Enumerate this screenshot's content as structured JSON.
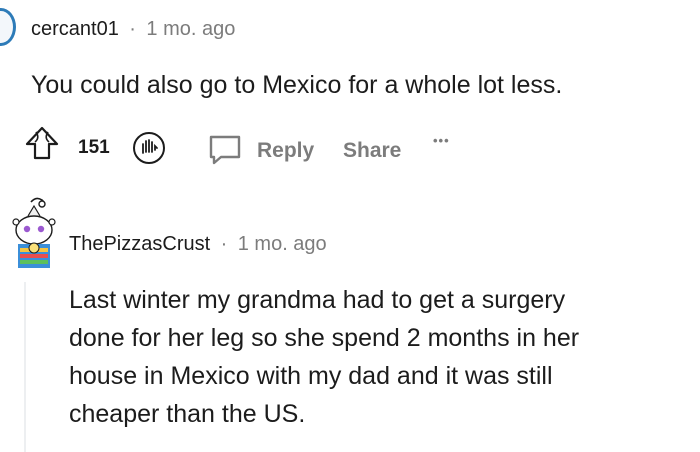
{
  "comment1": {
    "username": "cercant01",
    "separator": "·",
    "time": "1 mo. ago",
    "body": "You could also go to Mexico for a whole lot less.",
    "votes": "151",
    "reply_label": "Reply",
    "share_label": "Share",
    "more_label": "•••"
  },
  "comment2": {
    "username": "ThePizzasCrust",
    "separator": "·",
    "time": "1 mo. ago",
    "body_lines": [
      "Last winter my grandma had to get a surgery",
      "done for her leg so she spend 2 months in her",
      "house in Mexico with my dad and it was still",
      "cheaper than the US."
    ]
  },
  "colors": {
    "text": "#1c1c1c",
    "meta": "#7c7c7c",
    "avatar_ring": "#2d7bb8",
    "thread_line": "#edeff1"
  }
}
